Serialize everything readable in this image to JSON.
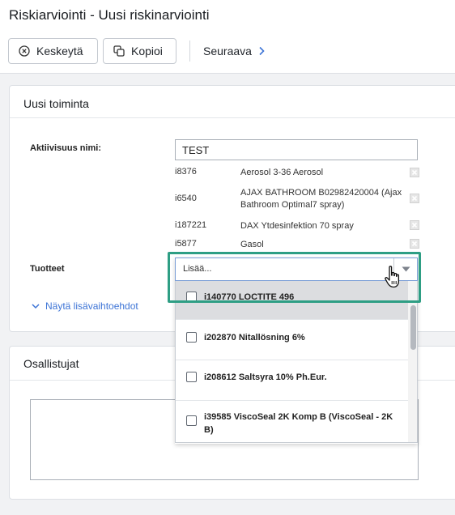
{
  "header": {
    "title": "Riskiarviointi - Uusi riskinarviointi",
    "cancel_label": "Keskeytä",
    "copy_label": "Kopioi",
    "next_label": "Seuraava"
  },
  "activity_card": {
    "title": "Uusi toiminta",
    "name_label": "Aktiivisuus nimi:",
    "name_value": "TEST",
    "products_label": "Tuotteet",
    "more_options_label": "Näytä lisävaihtoehdot",
    "selected_products": [
      {
        "code": "i8376",
        "name": "Aerosol 3-36 Aerosol"
      },
      {
        "code": "i6540",
        "name": "AJAX BATHROOM B02982420004 (Ajax Bathroom Optimal7 spray)"
      },
      {
        "code": "i187221",
        "name": "DAX Ytdesinfektion 70 spray"
      },
      {
        "code": "i5877",
        "name": "Gasol"
      }
    ]
  },
  "product_dropdown": {
    "placeholder": "Lisää...",
    "options": [
      {
        "label": "i140770 LOCTITE 496",
        "checked": false
      },
      {
        "label": "i202870 Nitallösning 6%",
        "checked": false
      },
      {
        "label": "i208612 Saltsyra 10% Ph.Eur.",
        "checked": false
      },
      {
        "label": "i39585 ViscoSeal 2K Komp B (ViscoSeal - 2K B)",
        "checked": false
      }
    ]
  },
  "participants_card": {
    "title": "Osallistujat"
  },
  "colors": {
    "accent": "#3d74d6",
    "highlight": "#2e9e84"
  }
}
